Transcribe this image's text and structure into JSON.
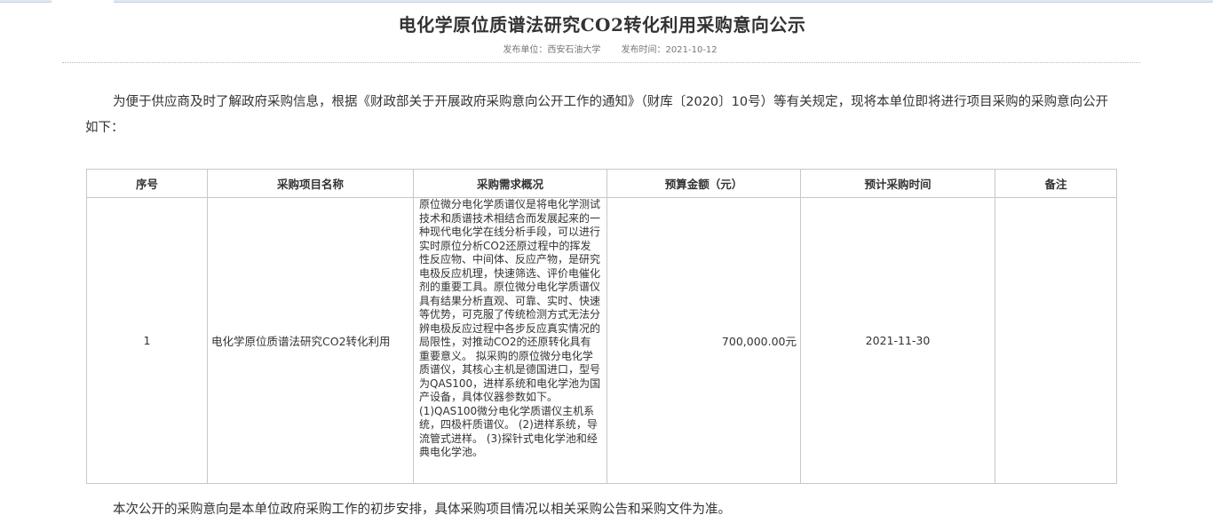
{
  "notice": {
    "title": "电化学原位质谱法研究CO2转化利用采购意向公示",
    "publisher": "发布单位：西安石油大学",
    "publish_time": "发布时间：2021-10-12",
    "intro": "为便于供应商及时了解政府采购信息，根据《财政部关于开展政府采购意向公开工作的通知》（财库〔2020〕10号）等有关规定，现将本单位即将进行项目采购的采购意向公开如下：",
    "closing": "本次公开的采购意向是本单位政府采购工作的初步安排，具体采购项目情况以相关采购公告和采购文件为准。"
  },
  "table": {
    "headers": [
      "序号",
      "采购项目名称",
      "采购需求概况",
      "预算金额（元）",
      "预计采购时间",
      "备注"
    ],
    "rows": [
      {
        "index": "1",
        "project_name": "电化学原位质谱法研究CO2转化利用",
        "description": "原位微分电化学质谱仪是将电化学测试技术和质谱技术相结合而发展起来的一种现代电化学在线分析手段，可以进行实时原位分析CO2还原过程中的挥发性反应物、中间体、反应产物，是研究电极反应机理，快速筛选、评价电催化剂的重要工具。原位微分电化学质谱仪具有结果分析直观、可靠、实时、快速等优势，可克服了传统检测方式无法分辨电极反应过程中各步反应真实情况的局限性，对推动CO2的还原转化具有重要意义。 拟采购的原位微分电化学质谱仪，其核心主机是德国进口，型号为QAS100，进样系统和电化学池为国产设备，具体仪器参数如下。 (1)QAS100微分电化学质谱仪主机系统，四极杆质谱仪。 (2)进样系统，导流管式进样。 (3)探针式电化学池和经典电化学池。",
        "budget": "700,000.00元",
        "expected_time": "2021-11-30",
        "remarks": ""
      }
    ]
  }
}
